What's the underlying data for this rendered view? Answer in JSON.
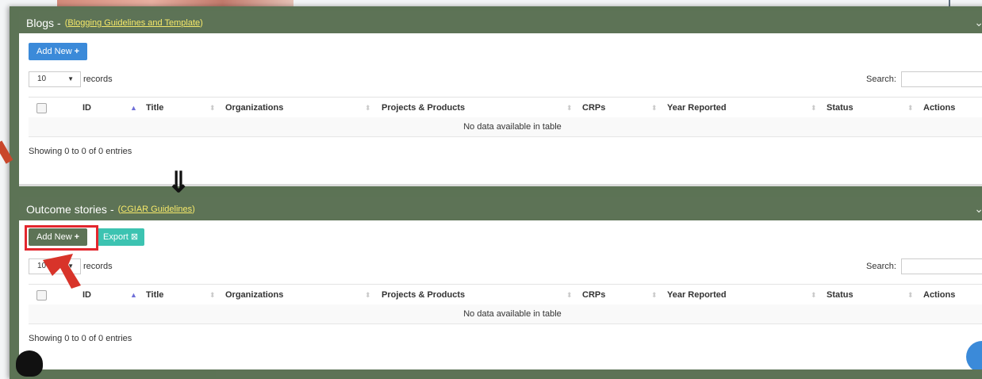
{
  "blogs": {
    "title": "Blogs",
    "separator": "-",
    "paren_open": "(",
    "guidelines_link": "Blogging Guidelines and Template",
    "paren_close": ")",
    "add_new_label": "Add New",
    "length": {
      "value": "10",
      "suffix": "records"
    },
    "search_label": "Search:",
    "columns": [
      "ID",
      "Title",
      "Organizations",
      "Projects & Products",
      "CRPs",
      "Year Reported",
      "Status",
      "Actions"
    ],
    "empty_message": "No data available in table",
    "info": "Showing 0 to 0 of 0 entries"
  },
  "outcomes": {
    "title": "Outcome stories",
    "separator": "-",
    "paren_open": "(",
    "guidelines_link": "CGIAR Guidelines",
    "paren_close": ")",
    "add_new_label": "Add New",
    "export_label": "Export",
    "length": {
      "value": "10",
      "suffix": "records"
    },
    "search_label": "Search:",
    "columns": [
      "ID",
      "Title",
      "Organizations",
      "Projects & Products",
      "CRPs",
      "Year Reported",
      "Status",
      "Actions"
    ],
    "empty_message": "No data available in table",
    "info": "Showing 0 to 0 of 0 entries"
  },
  "icons": {
    "plus": "+",
    "export": "⊠",
    "chevron": "⌄",
    "caret": "▼",
    "sort_active": "▲",
    "sort": "⬍",
    "arrow_down": "⇓"
  },
  "colors": {
    "panel_header": "#5d7356",
    "link": "#f6e96a",
    "add_new_blue": "#3b8ad9",
    "export_teal": "#3cc3b1",
    "highlight_red": "#e3262d"
  }
}
